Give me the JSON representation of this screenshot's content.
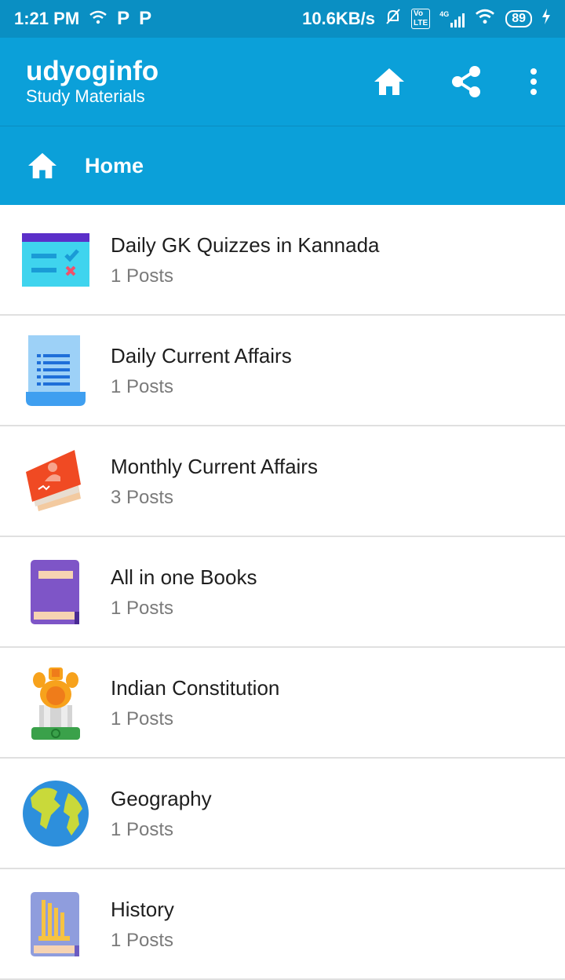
{
  "status_bar": {
    "time": "1:21 PM",
    "data_speed": "10.6KB/s",
    "network": "4G",
    "battery": "89",
    "icons": [
      "wifi-icon",
      "p-icon",
      "p-icon",
      "mute-icon",
      "volte-icon",
      "signal-icon",
      "wifi-icon",
      "battery-icon",
      "charging-icon"
    ]
  },
  "appbar": {
    "title": "udyoginfo",
    "subtitle": "Study Materials",
    "actions": [
      "home-icon",
      "share-icon",
      "more-vert-icon"
    ]
  },
  "breadcrumb": {
    "label": "Home",
    "icon": "home-icon"
  },
  "categories": [
    {
      "title": "Daily GK Quizzes in Kannada",
      "count": "1 Posts",
      "icon": "quiz-icon"
    },
    {
      "title": "Daily Current Affairs",
      "count": "1 Posts",
      "icon": "document-list-icon"
    },
    {
      "title": "Monthly Current Affairs",
      "count": "3 Posts",
      "icon": "magazine-icon"
    },
    {
      "title": "All in one  Books",
      "count": "1 Posts",
      "icon": "book-icon"
    },
    {
      "title": "Indian Constitution",
      "count": "1 Posts",
      "icon": "emblem-icon"
    },
    {
      "title": "Geography",
      "count": "1 Posts",
      "icon": "globe-icon"
    },
    {
      "title": "History",
      "count": "1 Posts",
      "icon": "history-book-icon"
    }
  ],
  "colors": {
    "status_bar": "#0a8fc3",
    "app_bar": "#0ba0d9",
    "divider": "#e0e0e0"
  }
}
